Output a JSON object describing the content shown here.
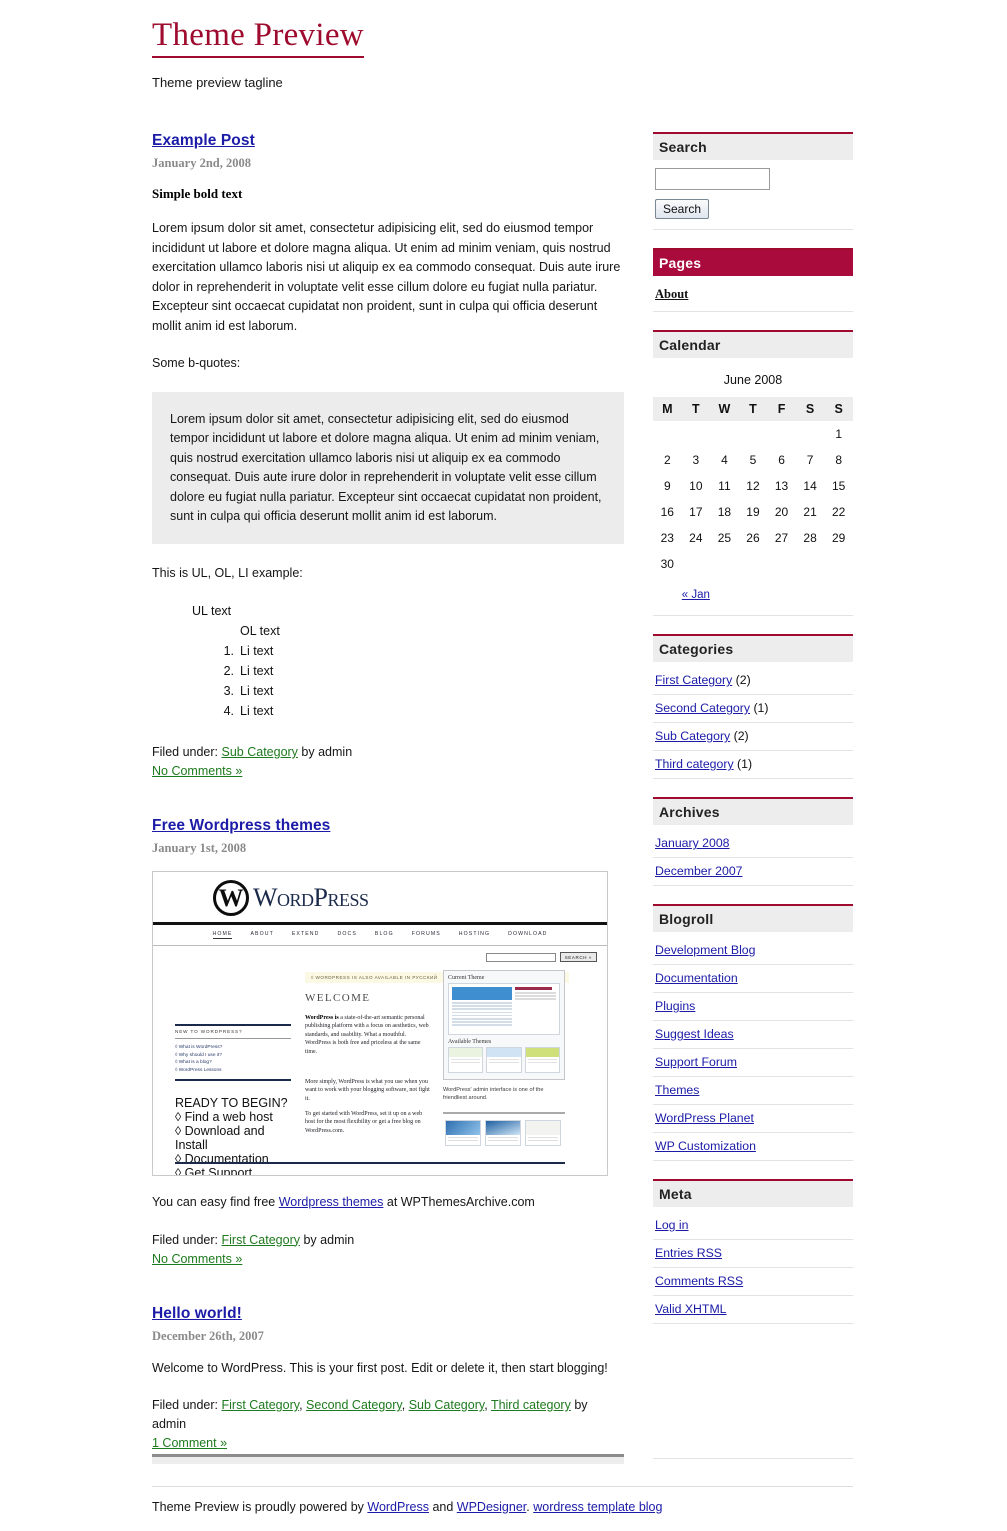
{
  "header": {
    "title": "Theme Preview",
    "tagline": "Theme preview tagline"
  },
  "posts": [
    {
      "title": "Example Post",
      "date": "January 2nd, 2008",
      "bold_text": "Simple bold text",
      "paragraph": "Lorem ipsum dolor sit amet, consectetur adipisicing elit, sed do eiusmod tempor incididunt ut labore et dolore magna aliqua. Ut enim ad minim veniam, quis nostrud exercitation ullamco laboris nisi ut aliquip ex ea commodo consequat. Duis aute irure dolor in reprehenderit in voluptate velit esse cillum dolore eu fugiat nulla pariatur. Excepteur sint occaecat cupidatat non proident, sunt in culpa qui officia deserunt mollit anim id est laborum.",
      "quote_intro": "Some b-quotes:",
      "blockquote": "Lorem ipsum dolor sit amet, consectetur adipisicing elit, sed do eiusmod tempor incididunt ut labore et dolore magna aliqua. Ut enim ad minim veniam, quis nostrud exercitation ullamco laboris nisi ut aliquip ex ea commodo consequat. Duis aute irure dolor in reprehenderit in voluptate velit esse cillum dolore eu fugiat nulla pariatur. Excepteur sint occaecat cupidatat non proident, sunt in culpa qui officia deserunt mollit anim id est laborum.",
      "list_intro": "This is UL, OL, LI example:",
      "ul_item": "UL text",
      "ol_item": "OL text",
      "li_items": [
        {
          "n": "1.",
          "label": "Li text"
        },
        {
          "n": "2.",
          "label": "Li text"
        },
        {
          "n": "3.",
          "label": "Li text"
        },
        {
          "n": "4.",
          "label": "Li text"
        }
      ],
      "filed_prefix": "Filed under:",
      "categories": [
        "Sub Category"
      ],
      "by_author": "by admin",
      "comments": "No Comments »"
    },
    {
      "title": "Free Wordpress themes",
      "date": "January 1st, 2008",
      "caption_before": "You can easy find free ",
      "caption_link": "Wordpress themes",
      "caption_after": " at WPThemesArchive.com",
      "filed_prefix": "Filed under:",
      "categories": [
        "First Category"
      ],
      "by_author": "by admin",
      "comments": "No Comments »"
    },
    {
      "title": "Hello world!",
      "date": "December 26th, 2007",
      "paragraph": "Welcome to WordPress. This is your first post. Edit or delete it, then start blogging!",
      "filed_prefix": "Filed under:",
      "categories": [
        "First Category",
        "Second Category",
        "Sub Category",
        "Third category"
      ],
      "by_author": "by admin",
      "comments": "1 Comment »"
    }
  ],
  "screenshot": {
    "logo_mark": "W",
    "logo_word": "WordPress",
    "nav": [
      "HOME",
      "ABOUT",
      "EXTEND",
      "DOCS",
      "BLOG",
      "FORUMS",
      "HOSTING",
      "DOWNLOAD"
    ],
    "search_button": "SEARCH »",
    "notice": "◊ WORDPRESS IS ALSO AVAILABLE IN РУССКИЙ",
    "welcome_heading": "WELCOME",
    "new_heading": "NEW TO WORDPRESS?",
    "new_links": [
      "◊ What is WordPress?",
      "◊ Why should I use it?",
      "◊ What is a blog?",
      "◊ WordPress Lessons"
    ],
    "body1_strong": "WordPress is",
    "body1": " a state-of-the-art semantic personal publishing platform with a focus on aesthetics, web standards, and usability. What a mouthful. WordPress is both free and priceless at the same time.",
    "body2": "More simply, WordPress is what you use when you want to work with your blogging software, not fight it.",
    "ready_heading": "READY TO BEGIN?",
    "ready_links": [
      "◊ Find a web host",
      "◊ Download and Install",
      "◊ Documentation",
      "◊ Get Support"
    ],
    "body3_pre": "To get started with WordPress, ",
    "body3_link1": "set it up on a web host",
    "body3_mid": " for the most flexibility or ",
    "body3_link2": "get a free blog on WordPress.com",
    "body3_end": ".",
    "panel_title": "Current Theme",
    "panel_title2": "Available Themes",
    "panel_caption": "WordPress' admin interface is one of the friendliest around."
  },
  "sidebar": {
    "search": {
      "title": "Search",
      "value": "",
      "placeholder": "",
      "button": "Search"
    },
    "pages": {
      "title": "Pages",
      "items": [
        "About"
      ]
    },
    "calendar": {
      "title": "Calendar",
      "caption": "June 2008",
      "weekdays": [
        "M",
        "T",
        "W",
        "T",
        "F",
        "S",
        "S"
      ],
      "weeks": [
        [
          "",
          "",
          "",
          "",
          "",
          "",
          "1"
        ],
        [
          "2",
          "3",
          "4",
          "5",
          "6",
          "7",
          "8"
        ],
        [
          "9",
          "10",
          "11",
          "12",
          "13",
          "14",
          "15"
        ],
        [
          "16",
          "17",
          "18",
          "19",
          "20",
          "21",
          "22"
        ],
        [
          "23",
          "24",
          "25",
          "26",
          "27",
          "28",
          "29"
        ],
        [
          "30",
          "",
          "",
          "",
          "",
          "",
          ""
        ]
      ],
      "prev_link": "« Jan"
    },
    "categories": {
      "title": "Categories",
      "items": [
        {
          "label": "First Category",
          "count": "(2)"
        },
        {
          "label": "Second Category",
          "count": "(1)"
        },
        {
          "label": "Sub Category",
          "count": "(2)"
        },
        {
          "label": "Third category",
          "count": "(1)"
        }
      ]
    },
    "archives": {
      "title": "Archives",
      "items": [
        "January 2008",
        "December 2007"
      ]
    },
    "blogroll": {
      "title": "Blogroll",
      "items": [
        "Development Blog",
        "Documentation",
        "Plugins",
        "Suggest Ideas",
        "Support Forum",
        "Themes",
        "WordPress Planet",
        "WP Customization"
      ]
    },
    "meta": {
      "title": "Meta",
      "items": [
        "Log in",
        "Entries RSS",
        "Comments RSS",
        "Valid XHTML"
      ]
    }
  },
  "footer": {
    "pre": "Theme Preview is proudly powered by ",
    "link1": "WordPress",
    "mid": " and ",
    "link2": "WPDesigner",
    "sep": ". ",
    "link3": "wordress template blog"
  },
  "colors": {
    "accent": "#9E0B2E",
    "accent_fill": "#A80B3C",
    "link": "#1B1BA8",
    "green_link": "#1E7A1E",
    "widget_bg": "#EDEDED"
  }
}
